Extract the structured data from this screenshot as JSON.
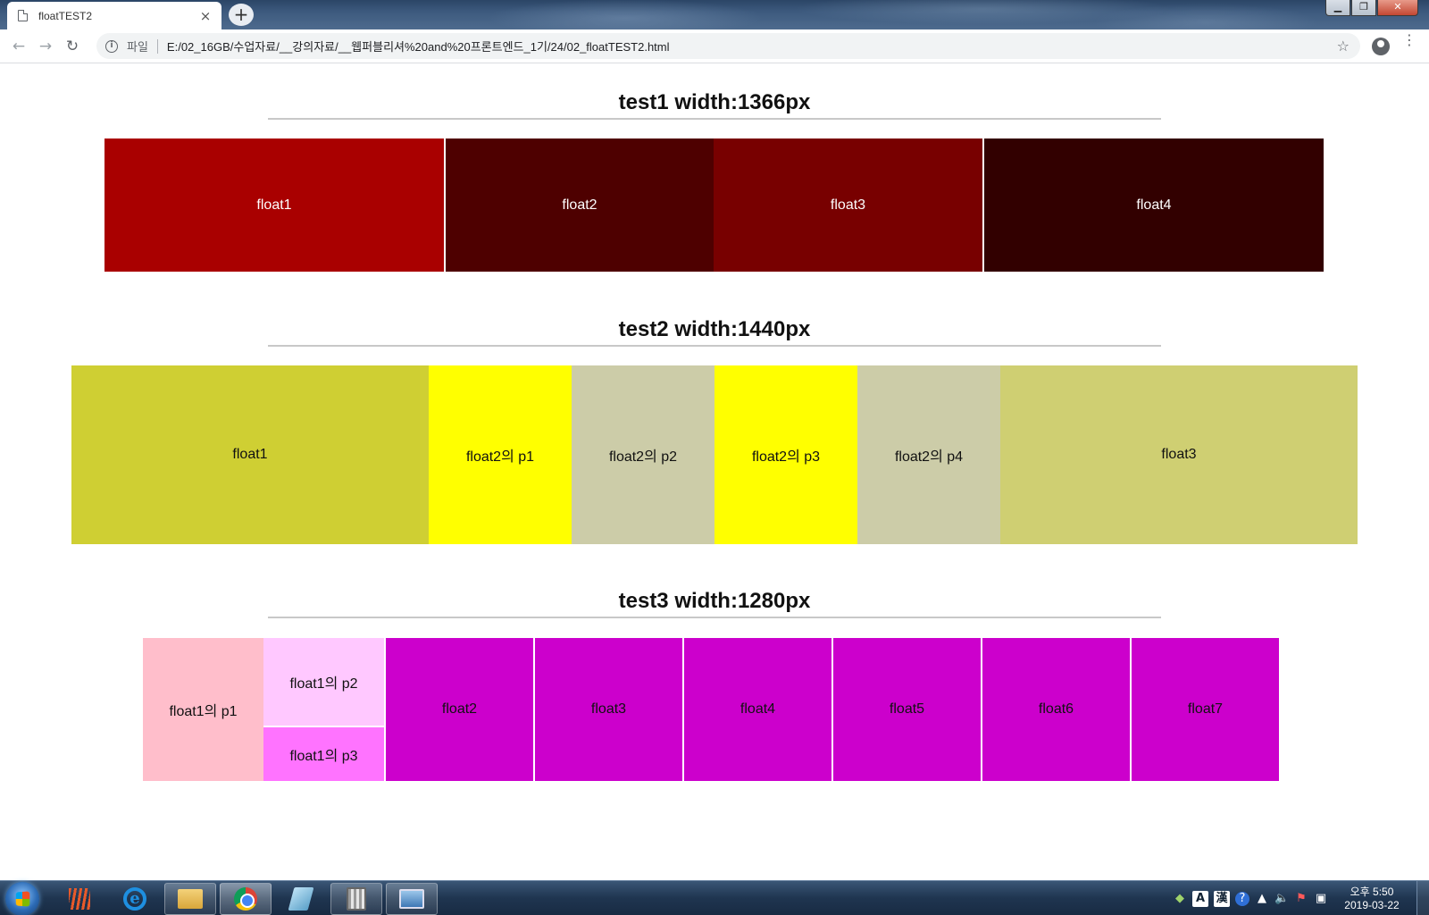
{
  "browser": {
    "tab_title": "floatTEST2",
    "tab_close": "×",
    "new_tab": "+",
    "window_buttons": {
      "minimize": "▁",
      "maximize": "❐",
      "close": "✕"
    },
    "nav": {
      "back": "←",
      "forward": "→",
      "reload": "↻"
    },
    "address": {
      "info_icon": "i",
      "scheme_label": "파일",
      "url": "E:/02_16GB/수업자료/__강의자료/__웹퍼블리셔%20and%20프론트엔드_1기/24/02_floatTEST2.html"
    },
    "bookmark_star": "☆",
    "menu_dots": "⋮"
  },
  "sections": [
    {
      "title": "test1 width:1366px",
      "boxes": [
        {
          "label": "float1",
          "color": "#a90000"
        },
        {
          "label": "float2",
          "color": "#4e0000"
        },
        {
          "label": "float3",
          "color": "#780000"
        },
        {
          "label": "float4",
          "color": "#320000"
        }
      ]
    },
    {
      "title": "test2 width:1440px",
      "boxes": [
        {
          "label": "float1",
          "color": "#cfcf33"
        },
        {
          "label": "float2의 p1",
          "color": "#ffff00"
        },
        {
          "label": "float2의 p2",
          "color": "#cccca8"
        },
        {
          "label": "float2의 p3",
          "color": "#ffff00"
        },
        {
          "label": "float2의 p4",
          "color": "#cccca8"
        },
        {
          "label": "float3",
          "color": "#cfcf72"
        }
      ]
    },
    {
      "title": "test3 width:1280px",
      "boxes": [
        {
          "label": "float1의 p1",
          "color": "#ffbecb"
        },
        {
          "label": "float1의 p2",
          "color": "#ffc8ff"
        },
        {
          "label": "float1의 p3",
          "color": "#ff73ff"
        },
        {
          "label": "float2",
          "color": "#cc00cc"
        },
        {
          "label": "float3",
          "color": "#cc00cc"
        },
        {
          "label": "float4",
          "color": "#cc00cc"
        },
        {
          "label": "float5",
          "color": "#cc00cc"
        },
        {
          "label": "float6",
          "color": "#cc00cc"
        },
        {
          "label": "float7",
          "color": "#cc00cc"
        }
      ]
    }
  ],
  "taskbar": {
    "apps": [
      "windows-start-icon",
      "photoshop-icon",
      "internet-explorer-icon",
      "file-explorer-icon",
      "chrome-icon",
      "pen-icon",
      "calculator-icon",
      "snipping-tool-icon"
    ],
    "tray": {
      "ime_a": "A",
      "ime_han": "漢",
      "help": "?",
      "arrow": "▲",
      "volume": "🔈",
      "flag": "⚑",
      "network": "▣"
    },
    "clock_time": "오후 5:50",
    "clock_date": "2019-03-22"
  }
}
